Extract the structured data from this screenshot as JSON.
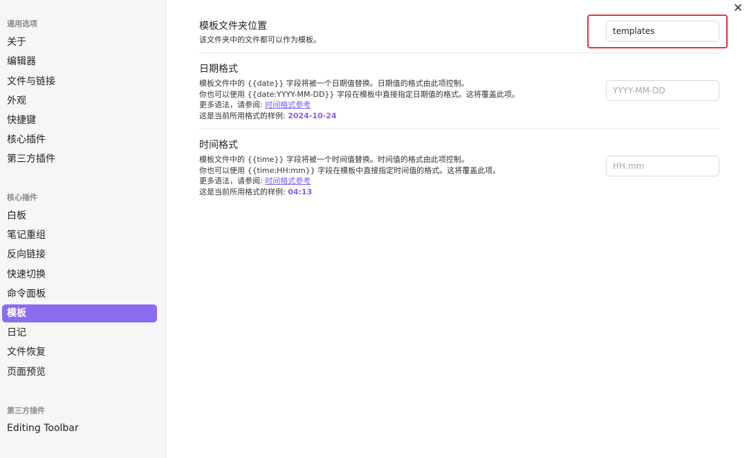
{
  "sidebar": {
    "sections": [
      {
        "title": "通用选项",
        "items": [
          "关于",
          "编辑器",
          "文件与链接",
          "外观",
          "快捷键",
          "核心插件",
          "第三方插件"
        ]
      },
      {
        "title": "核心插件",
        "items": [
          "白板",
          "笔记重组",
          "反向链接",
          "快速切换",
          "命令面板",
          "模板",
          "日记",
          "文件恢复",
          "页面预览"
        ]
      },
      {
        "title": "第三方插件",
        "items": [
          "Editing Toolbar"
        ]
      }
    ],
    "active_item": "模板"
  },
  "close": {
    "label": "✕"
  },
  "settings": {
    "folder": {
      "title": "模板文件夹位置",
      "desc": "该文件夹中的文件都可以作为模板。",
      "value": "templates",
      "placeholder": ""
    },
    "date": {
      "title": "日期格式",
      "line1": "模板文件中的 {{date}} 字段将被一个日期值替换。日期值的格式由此项控制。",
      "line2": "你也可以使用 {{date:YYYY-MM-DD}} 字段在模板中直接指定日期值的格式。这将覆盖此项。",
      "more_prefix": "更多语法，请参阅: ",
      "link": "时间格式参考",
      "sample_prefix": "这是当前所用格式的样例: ",
      "sample": "2024-10-24",
      "placeholder": "YYYY-MM-DD",
      "value": ""
    },
    "time": {
      "title": "时间格式",
      "line1": "模板文件中的 {{time}} 字段将被一个时间值替换。时间值的格式由此项控制。",
      "line2": "你也可以使用 {{time:HH:mm}} 字段在模板中直接指定时间值的格式。这将覆盖此项。",
      "more_prefix": "更多语法，请参阅: ",
      "link": "时间格式参考",
      "sample_prefix": "这是当前所用格式的样例: ",
      "sample": "04:13",
      "placeholder": "HH:mm",
      "value": ""
    }
  },
  "colors": {
    "accent": "#8b6cf0",
    "highlight": "#e8322b"
  }
}
